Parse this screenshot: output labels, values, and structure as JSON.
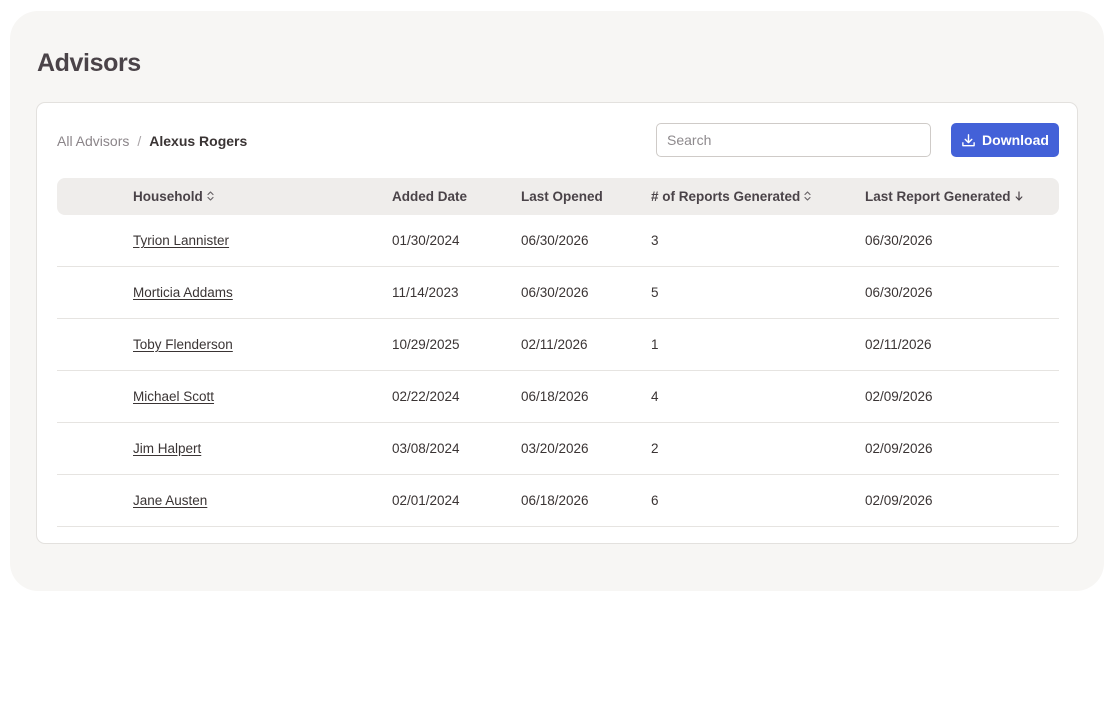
{
  "page": {
    "title": "Advisors"
  },
  "breadcrumb": {
    "parent": "All Advisors",
    "separator": "/",
    "current": "Alexus Rogers"
  },
  "search": {
    "placeholder": "Search",
    "value": ""
  },
  "download": {
    "label": "Download",
    "color": "#4361d8",
    "icon": "download-icon"
  },
  "table": {
    "headers": {
      "household": "Household",
      "added_date": "Added Date",
      "last_opened": "Last Opened",
      "reports_generated": "# of Reports Generated",
      "last_report_generated": "Last Report Generated"
    },
    "sort": {
      "household": "sortable",
      "reports_generated": "sortable",
      "last_report_generated": "descending"
    },
    "rows": [
      {
        "household": "Tyrion Lannister",
        "added_date": "01/30/2024",
        "last_opened": "06/30/2026",
        "reports": "3",
        "last_report": "06/30/2026"
      },
      {
        "household": "Morticia Addams",
        "added_date": "11/14/2023",
        "last_opened": "06/30/2026",
        "reports": "5",
        "last_report": "06/30/2026"
      },
      {
        "household": "Toby Flenderson",
        "added_date": "10/29/2025",
        "last_opened": "02/11/2026",
        "reports": "1",
        "last_report": "02/11/2026"
      },
      {
        "household": "Michael Scott",
        "added_date": "02/22/2024",
        "last_opened": "06/18/2026",
        "reports": "4",
        "last_report": "02/09/2026"
      },
      {
        "household": "Jim Halpert",
        "added_date": "03/08/2024",
        "last_opened": "03/20/2026",
        "reports": "2",
        "last_report": "02/09/2026"
      },
      {
        "household": "Jane Austen",
        "added_date": "02/01/2024",
        "last_opened": "06/18/2026",
        "reports": "6",
        "last_report": "02/09/2026"
      }
    ]
  }
}
